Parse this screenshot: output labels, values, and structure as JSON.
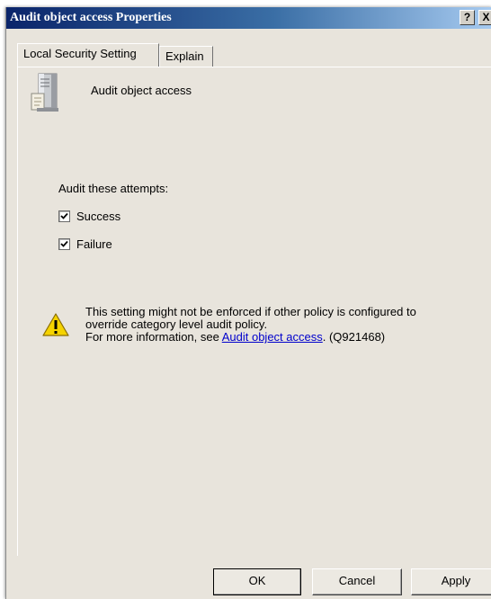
{
  "window": {
    "title": "Audit object access Properties",
    "help_button": "?",
    "close_button": "X"
  },
  "tabs": [
    {
      "label": "Local Security Setting",
      "active": true
    },
    {
      "label": "Explain",
      "active": false
    }
  ],
  "policy": {
    "icon": "server-icon",
    "name": "Audit object access"
  },
  "attempts": {
    "label": "Audit these attempts:",
    "options": [
      {
        "label": "Success",
        "checked": true
      },
      {
        "label": "Failure",
        "checked": true
      }
    ]
  },
  "warning": {
    "icon": "warning-icon",
    "line1": "This setting might not be enforced if other policy is configured to",
    "line2": "override category level audit policy.",
    "line3_prefix": "For more information, see ",
    "link_text": "Audit object access",
    "line3_suffix": ". (Q921468)"
  },
  "buttons": {
    "ok": "OK",
    "cancel": "Cancel",
    "apply": "Apply"
  },
  "colors": {
    "titlebar_start": "#0a246a",
    "titlebar_end": "#a6caf0",
    "dialog_bg": "#e8e4dc",
    "link": "#0000cc",
    "warning_yellow": "#f5d300"
  }
}
